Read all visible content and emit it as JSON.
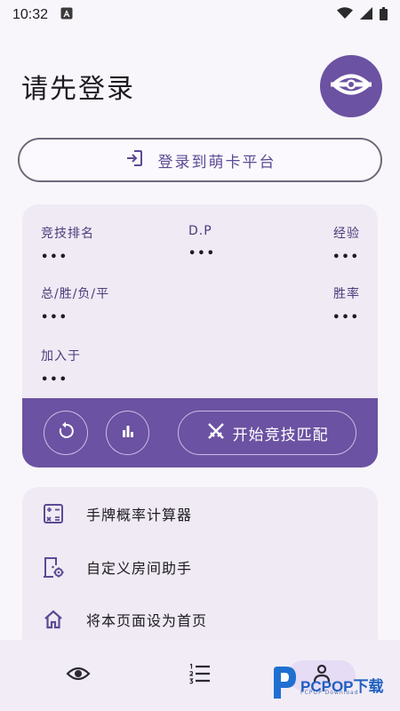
{
  "status_bar": {
    "time": "10:32",
    "icons": [
      "notification-a-icon",
      "wifi-icon",
      "signal-icon",
      "battery-icon"
    ]
  },
  "header": {
    "title": "请先登录",
    "avatar_icon": "eye-icon"
  },
  "login": {
    "label": "登录到萌卡平台",
    "icon": "login-icon"
  },
  "stats": {
    "rank_label": "竞技排名",
    "rank_value": "•••",
    "dp_label": "D.P",
    "dp_value": "•••",
    "exp_label": "经验",
    "exp_value": "•••",
    "record_label": "总/胜/负/平",
    "record_value": "•••",
    "winrate_label": "胜率",
    "winrate_value": "•••",
    "joined_label": "加入于",
    "joined_value": "•••"
  },
  "actions": {
    "refresh_icon": "refresh-icon",
    "chart_icon": "bar-chart-icon",
    "match_label": "开始竞技匹配",
    "match_icon": "swords-icon"
  },
  "menu": {
    "items": [
      {
        "label": "手牌概率计算器",
        "icon": "calculator-icon"
      },
      {
        "label": "自定义房间助手",
        "icon": "room-settings-icon"
      },
      {
        "label": "将本页面设为首页",
        "icon": "home-icon"
      }
    ]
  },
  "bottom_nav": {
    "items": [
      "eye-icon",
      "list-icon",
      "account-icon"
    ]
  },
  "watermark": {
    "text": "PCPOP下载",
    "sub": "PCPOP Download"
  },
  "colors": {
    "accent": "#6b52a2",
    "accent_text": "#5d4a95",
    "card_bg": "#efeaf4",
    "page_bg": "#f8f6fb"
  }
}
